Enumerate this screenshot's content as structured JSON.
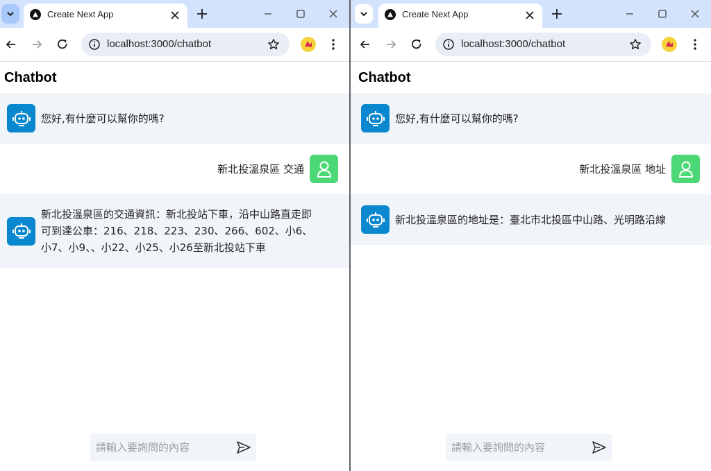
{
  "windows": [
    {
      "tab": {
        "title": "Create Next App"
      },
      "omnibox": {
        "url": "localhost:3000/chatbot"
      },
      "page": {
        "title": "Chatbot",
        "messages": [
          {
            "role": "bot",
            "lines": [
              "您好,有什麼可以幫你的嗎?"
            ]
          },
          {
            "role": "user",
            "lines": [
              "新北投溫泉區 交通"
            ]
          },
          {
            "role": "bot",
            "lines": [
              "新北投溫泉區的交通資訊：新北投站下車，沿中山路直走即",
              "可到達公車：216、218、223、230、266、602、小6、",
              "小7、小9、、小22、小25、小26至新北投站下車"
            ]
          }
        ],
        "input": {
          "placeholder": "請輸入要詢問的內容",
          "value": ""
        }
      }
    },
    {
      "tab": {
        "title": "Create Next App"
      },
      "omnibox": {
        "url": "localhost:3000/chatbot"
      },
      "page": {
        "title": "Chatbot",
        "messages": [
          {
            "role": "bot",
            "lines": [
              "您好,有什麼可以幫你的嗎?"
            ]
          },
          {
            "role": "user",
            "lines": [
              "新北投溫泉區 地址"
            ]
          },
          {
            "role": "bot",
            "lines": [
              "新北投溫泉區的地址是：臺北市北投區中山路、光明路沿線"
            ]
          }
        ],
        "input": {
          "placeholder": "請輸入要詢問的內容",
          "value": ""
        }
      }
    }
  ],
  "colors": {
    "tabstrip": "#d3e3fd",
    "bot_bubble_bg": "#f1f4f9",
    "bot_avatar": "#0a88cf",
    "user_avatar": "#4dd877"
  },
  "icons": {
    "tab_search": "chevron-down-icon",
    "favicon": "nextjs-triangle-icon",
    "tab_close": "close-icon",
    "new_tab": "plus-icon",
    "minimize": "minimize-icon",
    "maximize": "maximize-icon",
    "close_window": "close-icon",
    "back": "arrow-left-icon",
    "forward": "arrow-right-icon",
    "reload": "reload-icon",
    "site_info": "info-icon",
    "bookmark": "star-icon",
    "extension": "extension-icon",
    "menu": "more-vert-icon",
    "bot_avatar": "robot-icon",
    "user_avatar": "user-icon",
    "send": "send-icon"
  }
}
